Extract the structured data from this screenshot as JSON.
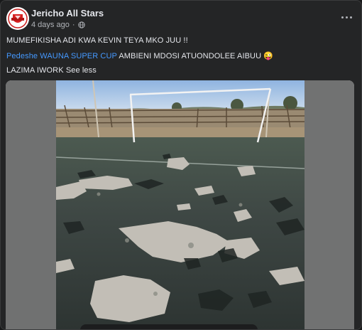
{
  "post": {
    "page_name": "Jericho All Stars",
    "time": "4 days ago",
    "privacy_icon": "globe-icon",
    "more_icon": "more-options-icon",
    "line1": "MUMEFIKISHA ADI KWA KEVIN TEYA  MKO JUU !!",
    "line2_tag1": "Pedeshe",
    "line2_tag2": "WAUNA SUPER CUP",
    "line2_text": " AMBIENI MDOSI ATUONDOLEE AIBUU ",
    "line2_emoji": "😜",
    "line3_text": "LAZIMA IWORK ",
    "see_less": "See less",
    "avatar_text": "JERICHO ALL STARS"
  },
  "colors": {
    "card_bg": "#242526",
    "link": "#4599ff",
    "text": "#e4e6eb",
    "muted": "#b0b3b8"
  }
}
